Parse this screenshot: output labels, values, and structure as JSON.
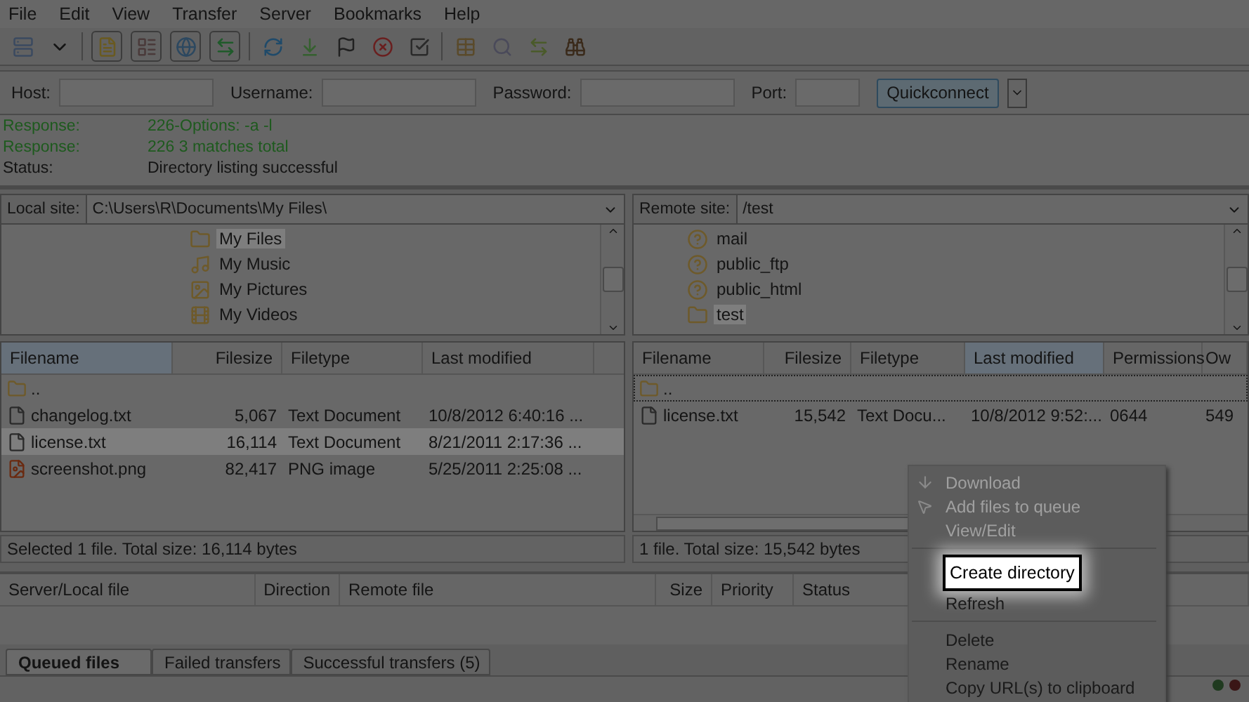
{
  "menu_bar": [
    {
      "label": "File"
    },
    {
      "label": "Edit"
    },
    {
      "label": "View"
    },
    {
      "label": "Transfer"
    },
    {
      "label": "Server"
    },
    {
      "label": "Bookmarks"
    },
    {
      "label": "Help"
    }
  ],
  "quickconnect": {
    "fields": [
      {
        "label": "Host:"
      },
      {
        "label": "Username:"
      },
      {
        "label": "Password:"
      },
      {
        "label": "Port:"
      }
    ],
    "button": "Quickconnect"
  },
  "message_log": [
    {
      "kind": "response",
      "label": "Response:",
      "text": "226-Options: -a -l"
    },
    {
      "kind": "response",
      "label": "Response:",
      "text": "226 3 matches total"
    },
    {
      "kind": "status",
      "label": "Status:",
      "text": "Directory listing successful"
    }
  ],
  "local_site": {
    "label": "Local site:",
    "path": "C:\\Users\\R\\Documents\\My Files\\",
    "tree": [
      {
        "name": "My Files",
        "kind": "folder",
        "selected": true
      },
      {
        "name": "My Music",
        "kind": "music",
        "selected": false
      },
      {
        "name": "My Pictures",
        "kind": "pictures",
        "selected": false
      },
      {
        "name": "My Videos",
        "kind": "videos",
        "selected": false
      }
    ]
  },
  "remote_site": {
    "label": "Remote site:",
    "path": "/test",
    "tree": [
      {
        "name": "mail",
        "kind": "unknown",
        "selected": false
      },
      {
        "name": "public_ftp",
        "kind": "unknown",
        "selected": false
      },
      {
        "name": "public_html",
        "kind": "unknown",
        "selected": false
      },
      {
        "name": "test",
        "kind": "folder",
        "selected": true
      }
    ]
  },
  "local_files": {
    "columns": [
      "Filename",
      "Filesize",
      "Filetype",
      "Last modified"
    ],
    "rows": [
      {
        "kind": "folder",
        "cells": [
          ".."
        ],
        "selected": false,
        "focused": false
      },
      {
        "kind": "text",
        "cells": [
          "changelog.txt",
          "5,067",
          "Text Document",
          "10/8/2012 6:40:16 ..."
        ],
        "selected": false,
        "focused": false
      },
      {
        "kind": "text",
        "cells": [
          "license.txt",
          "16,114",
          "Text Document",
          "8/21/2011 2:17:36 ..."
        ],
        "selected": true,
        "focused": false
      },
      {
        "kind": "image",
        "cells": [
          "screenshot.png",
          "82,417",
          "PNG image",
          "5/25/2011 2:25:08 ..."
        ],
        "selected": false,
        "focused": false
      }
    ]
  },
  "remote_files": {
    "columns": [
      "Filename",
      "Filesize",
      "Filetype",
      "Last modified",
      "Permissions",
      "Ow"
    ],
    "rows": [
      {
        "kind": "folder",
        "cells": [
          ".."
        ],
        "selected": false,
        "focused": true
      },
      {
        "kind": "text",
        "cells": [
          "license.txt",
          "15,542",
          "Text Docu...",
          "10/8/2012 9:52:...",
          "0644",
          "549"
        ],
        "selected": false,
        "focused": false
      }
    ]
  },
  "local_status": "Selected 1 file. Total size: 16,114 bytes",
  "remote_status": "1 file. Total size: 15,542 bytes",
  "queue": {
    "columns": [
      "Server/Local file",
      "Direction",
      "Remote file",
      "Size",
      "Priority",
      "Status"
    ]
  },
  "queue_tabs": [
    {
      "label": "Queued files",
      "selected": true
    },
    {
      "label": "Failed transfers",
      "selected": false
    },
    {
      "label": "Successful transfers (5)",
      "selected": false
    }
  ],
  "context_menu": {
    "items": [
      {
        "kind": "item",
        "label": "Download",
        "disabled": true,
        "highlighted": false
      },
      {
        "kind": "item",
        "label": "Add files to queue",
        "disabled": true,
        "highlighted": false
      },
      {
        "kind": "item",
        "label": "View/Edit",
        "disabled": true,
        "highlighted": false
      },
      {
        "kind": "separator"
      },
      {
        "kind": "item",
        "label": "Create directory",
        "disabled": false,
        "highlighted": true
      },
      {
        "kind": "item",
        "label": "Refresh",
        "disabled": false,
        "highlighted": false
      },
      {
        "kind": "separator"
      },
      {
        "kind": "item",
        "label": "Delete",
        "disabled": false,
        "highlighted": false
      },
      {
        "kind": "item",
        "label": "Rename",
        "disabled": false,
        "highlighted": false
      },
      {
        "kind": "item",
        "label": "Copy URL(s) to clipboard",
        "disabled": false,
        "highlighted": false
      }
    ]
  }
}
